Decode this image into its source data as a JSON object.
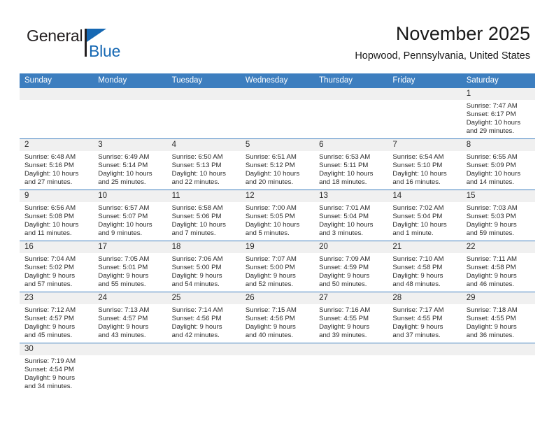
{
  "brand": {
    "name_part1": "General",
    "name_part2": "Blue",
    "triangle_icon": "blue-triangle-icon",
    "accent_color": "#1668b3"
  },
  "header": {
    "title": "November 2025",
    "subtitle": "Hopwood, Pennsylvania, United States"
  },
  "colors": {
    "header_bar": "#3d7ebf",
    "day_strip": "#f0f0f0",
    "text": "#2b2b2b"
  },
  "weekdays": [
    "Sunday",
    "Monday",
    "Tuesday",
    "Wednesday",
    "Thursday",
    "Friday",
    "Saturday"
  ],
  "weeks": [
    [
      {
        "day": "",
        "sunrise": "",
        "sunset": "",
        "daylight_l1": "",
        "daylight_l2": ""
      },
      {
        "day": "",
        "sunrise": "",
        "sunset": "",
        "daylight_l1": "",
        "daylight_l2": ""
      },
      {
        "day": "",
        "sunrise": "",
        "sunset": "",
        "daylight_l1": "",
        "daylight_l2": ""
      },
      {
        "day": "",
        "sunrise": "",
        "sunset": "",
        "daylight_l1": "",
        "daylight_l2": ""
      },
      {
        "day": "",
        "sunrise": "",
        "sunset": "",
        "daylight_l1": "",
        "daylight_l2": ""
      },
      {
        "day": "",
        "sunrise": "",
        "sunset": "",
        "daylight_l1": "",
        "daylight_l2": ""
      },
      {
        "day": "1",
        "sunrise": "Sunrise: 7:47 AM",
        "sunset": "Sunset: 6:17 PM",
        "daylight_l1": "Daylight: 10 hours",
        "daylight_l2": "and 29 minutes."
      }
    ],
    [
      {
        "day": "2",
        "sunrise": "Sunrise: 6:48 AM",
        "sunset": "Sunset: 5:16 PM",
        "daylight_l1": "Daylight: 10 hours",
        "daylight_l2": "and 27 minutes."
      },
      {
        "day": "3",
        "sunrise": "Sunrise: 6:49 AM",
        "sunset": "Sunset: 5:14 PM",
        "daylight_l1": "Daylight: 10 hours",
        "daylight_l2": "and 25 minutes."
      },
      {
        "day": "4",
        "sunrise": "Sunrise: 6:50 AM",
        "sunset": "Sunset: 5:13 PM",
        "daylight_l1": "Daylight: 10 hours",
        "daylight_l2": "and 22 minutes."
      },
      {
        "day": "5",
        "sunrise": "Sunrise: 6:51 AM",
        "sunset": "Sunset: 5:12 PM",
        "daylight_l1": "Daylight: 10 hours",
        "daylight_l2": "and 20 minutes."
      },
      {
        "day": "6",
        "sunrise": "Sunrise: 6:53 AM",
        "sunset": "Sunset: 5:11 PM",
        "daylight_l1": "Daylight: 10 hours",
        "daylight_l2": "and 18 minutes."
      },
      {
        "day": "7",
        "sunrise": "Sunrise: 6:54 AM",
        "sunset": "Sunset: 5:10 PM",
        "daylight_l1": "Daylight: 10 hours",
        "daylight_l2": "and 16 minutes."
      },
      {
        "day": "8",
        "sunrise": "Sunrise: 6:55 AM",
        "sunset": "Sunset: 5:09 PM",
        "daylight_l1": "Daylight: 10 hours",
        "daylight_l2": "and 14 minutes."
      }
    ],
    [
      {
        "day": "9",
        "sunrise": "Sunrise: 6:56 AM",
        "sunset": "Sunset: 5:08 PM",
        "daylight_l1": "Daylight: 10 hours",
        "daylight_l2": "and 11 minutes."
      },
      {
        "day": "10",
        "sunrise": "Sunrise: 6:57 AM",
        "sunset": "Sunset: 5:07 PM",
        "daylight_l1": "Daylight: 10 hours",
        "daylight_l2": "and 9 minutes."
      },
      {
        "day": "11",
        "sunrise": "Sunrise: 6:58 AM",
        "sunset": "Sunset: 5:06 PM",
        "daylight_l1": "Daylight: 10 hours",
        "daylight_l2": "and 7 minutes."
      },
      {
        "day": "12",
        "sunrise": "Sunrise: 7:00 AM",
        "sunset": "Sunset: 5:05 PM",
        "daylight_l1": "Daylight: 10 hours",
        "daylight_l2": "and 5 minutes."
      },
      {
        "day": "13",
        "sunrise": "Sunrise: 7:01 AM",
        "sunset": "Sunset: 5:04 PM",
        "daylight_l1": "Daylight: 10 hours",
        "daylight_l2": "and 3 minutes."
      },
      {
        "day": "14",
        "sunrise": "Sunrise: 7:02 AM",
        "sunset": "Sunset: 5:04 PM",
        "daylight_l1": "Daylight: 10 hours",
        "daylight_l2": "and 1 minute."
      },
      {
        "day": "15",
        "sunrise": "Sunrise: 7:03 AM",
        "sunset": "Sunset: 5:03 PM",
        "daylight_l1": "Daylight: 9 hours",
        "daylight_l2": "and 59 minutes."
      }
    ],
    [
      {
        "day": "16",
        "sunrise": "Sunrise: 7:04 AM",
        "sunset": "Sunset: 5:02 PM",
        "daylight_l1": "Daylight: 9 hours",
        "daylight_l2": "and 57 minutes."
      },
      {
        "day": "17",
        "sunrise": "Sunrise: 7:05 AM",
        "sunset": "Sunset: 5:01 PM",
        "daylight_l1": "Daylight: 9 hours",
        "daylight_l2": "and 55 minutes."
      },
      {
        "day": "18",
        "sunrise": "Sunrise: 7:06 AM",
        "sunset": "Sunset: 5:00 PM",
        "daylight_l1": "Daylight: 9 hours",
        "daylight_l2": "and 54 minutes."
      },
      {
        "day": "19",
        "sunrise": "Sunrise: 7:07 AM",
        "sunset": "Sunset: 5:00 PM",
        "daylight_l1": "Daylight: 9 hours",
        "daylight_l2": "and 52 minutes."
      },
      {
        "day": "20",
        "sunrise": "Sunrise: 7:09 AM",
        "sunset": "Sunset: 4:59 PM",
        "daylight_l1": "Daylight: 9 hours",
        "daylight_l2": "and 50 minutes."
      },
      {
        "day": "21",
        "sunrise": "Sunrise: 7:10 AM",
        "sunset": "Sunset: 4:58 PM",
        "daylight_l1": "Daylight: 9 hours",
        "daylight_l2": "and 48 minutes."
      },
      {
        "day": "22",
        "sunrise": "Sunrise: 7:11 AM",
        "sunset": "Sunset: 4:58 PM",
        "daylight_l1": "Daylight: 9 hours",
        "daylight_l2": "and 46 minutes."
      }
    ],
    [
      {
        "day": "23",
        "sunrise": "Sunrise: 7:12 AM",
        "sunset": "Sunset: 4:57 PM",
        "daylight_l1": "Daylight: 9 hours",
        "daylight_l2": "and 45 minutes."
      },
      {
        "day": "24",
        "sunrise": "Sunrise: 7:13 AM",
        "sunset": "Sunset: 4:57 PM",
        "daylight_l1": "Daylight: 9 hours",
        "daylight_l2": "and 43 minutes."
      },
      {
        "day": "25",
        "sunrise": "Sunrise: 7:14 AM",
        "sunset": "Sunset: 4:56 PM",
        "daylight_l1": "Daylight: 9 hours",
        "daylight_l2": "and 42 minutes."
      },
      {
        "day": "26",
        "sunrise": "Sunrise: 7:15 AM",
        "sunset": "Sunset: 4:56 PM",
        "daylight_l1": "Daylight: 9 hours",
        "daylight_l2": "and 40 minutes."
      },
      {
        "day": "27",
        "sunrise": "Sunrise: 7:16 AM",
        "sunset": "Sunset: 4:55 PM",
        "daylight_l1": "Daylight: 9 hours",
        "daylight_l2": "and 39 minutes."
      },
      {
        "day": "28",
        "sunrise": "Sunrise: 7:17 AM",
        "sunset": "Sunset: 4:55 PM",
        "daylight_l1": "Daylight: 9 hours",
        "daylight_l2": "and 37 minutes."
      },
      {
        "day": "29",
        "sunrise": "Sunrise: 7:18 AM",
        "sunset": "Sunset: 4:55 PM",
        "daylight_l1": "Daylight: 9 hours",
        "daylight_l2": "and 36 minutes."
      }
    ],
    [
      {
        "day": "30",
        "sunrise": "Sunrise: 7:19 AM",
        "sunset": "Sunset: 4:54 PM",
        "daylight_l1": "Daylight: 9 hours",
        "daylight_l2": "and 34 minutes."
      },
      {
        "day": "",
        "sunrise": "",
        "sunset": "",
        "daylight_l1": "",
        "daylight_l2": ""
      },
      {
        "day": "",
        "sunrise": "",
        "sunset": "",
        "daylight_l1": "",
        "daylight_l2": ""
      },
      {
        "day": "",
        "sunrise": "",
        "sunset": "",
        "daylight_l1": "",
        "daylight_l2": ""
      },
      {
        "day": "",
        "sunrise": "",
        "sunset": "",
        "daylight_l1": "",
        "daylight_l2": ""
      },
      {
        "day": "",
        "sunrise": "",
        "sunset": "",
        "daylight_l1": "",
        "daylight_l2": ""
      },
      {
        "day": "",
        "sunrise": "",
        "sunset": "",
        "daylight_l1": "",
        "daylight_l2": ""
      }
    ]
  ]
}
